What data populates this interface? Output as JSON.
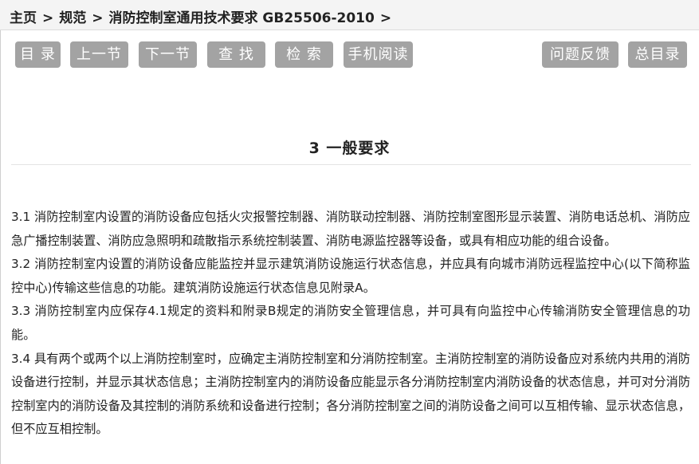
{
  "breadcrumb": {
    "home": "主页",
    "category": "规范",
    "document": "消防控制室通用技术要求 GB25506-2010",
    "sep": ">"
  },
  "toolbar": {
    "toc": "目 录",
    "prev": "上一节",
    "next": "下一节",
    "find": "查 找",
    "search": "检 索",
    "mobile": "手机阅读",
    "feedback": "问题反馈",
    "master_toc": "总目录"
  },
  "section": {
    "title": "3  一般要求",
    "paragraphs": [
      "3.1 消防控制室内设置的消防设备应包括火灾报警控制器、消防联动控制器、消防控制室图形显示装置、消防电话总机、消防应急广播控制装置、消防应急照明和疏散指示系统控制装置、消防电源监控器等设备，或具有相应功能的组合设备。",
      "3.2 消防控制室内设置的消防设备应能监控并显示建筑消防设施运行状态信息，并应具有向城市消防远程监控中心(以下简称监控中心)传输这些信息的功能。建筑消防设施运行状态信息见附录A。",
      "3.3 消防控制室内应保存4.1规定的资料和附录B规定的消防安全管理信息，并可具有向监控中心传输消防安全管理信息的功能。",
      "3.4 具有两个或两个以上消防控制室时，应确定主消防控制室和分消防控制室。主消防控制室的消防设备应对系统内共用的消防设备进行控制，并显示其状态信息；主消防控制室内的消防设备应能显示各分消防控制室内消防设备的状态信息，并可对分消防控制室内的消防设备及其控制的消防系统和设备进行控制；各分消防控制室之间的消防设备之间可以互相传输、显示状态信息，但不应互相控制。"
    ]
  }
}
